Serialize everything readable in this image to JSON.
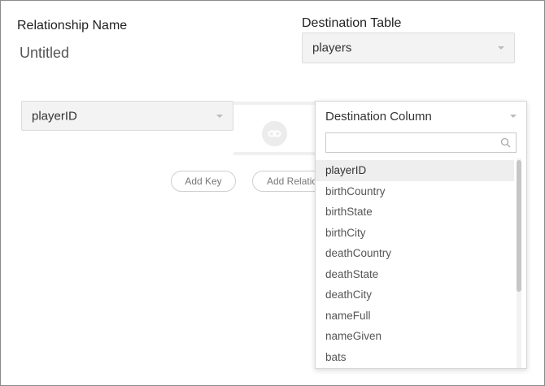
{
  "relationship": {
    "name_label": "Relationship Name",
    "name_value": "Untitled"
  },
  "destination_table": {
    "label": "Destination Table",
    "selected": "players"
  },
  "source_column": {
    "selected": "playerID"
  },
  "buttons": {
    "add_key": "Add Key",
    "add_relation": "Add Relation"
  },
  "destination_column": {
    "placeholder": "Destination Column",
    "search_value": "",
    "highlighted_index": 0,
    "options": [
      "playerID",
      "birthCountry",
      "birthState",
      "birthCity",
      "deathCountry",
      "deathState",
      "deathCity",
      "nameFull",
      "nameGiven",
      "bats"
    ]
  },
  "icons": {
    "caret": "chevron-down-icon",
    "link": "link-icon",
    "search": "search-icon"
  }
}
